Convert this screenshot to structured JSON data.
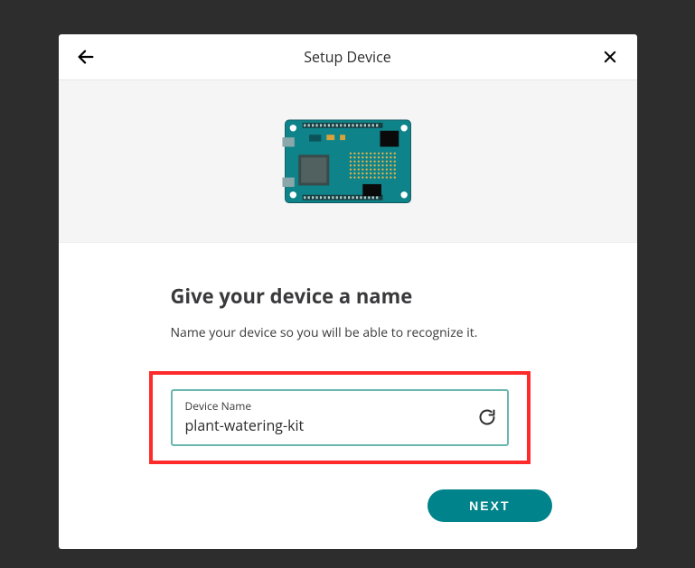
{
  "header": {
    "title": "Setup Device"
  },
  "main": {
    "heading": "Give your device a name",
    "description": "Name your device so you will be able to recognize it.",
    "input": {
      "label": "Device Name",
      "value": "plant-watering-kit"
    }
  },
  "footer": {
    "next_label": "NEXT"
  }
}
